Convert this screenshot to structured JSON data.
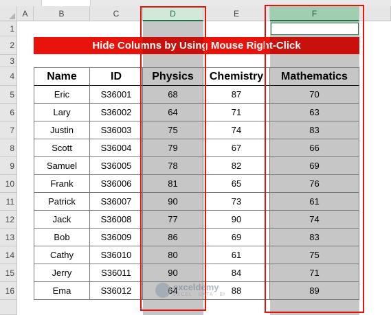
{
  "sheet": {
    "columns": [
      "A",
      "B",
      "C",
      "D",
      "E",
      "F"
    ],
    "rows": [
      "1",
      "2",
      "3",
      "4",
      "5",
      "6",
      "7",
      "8",
      "9",
      "10",
      "11",
      "12",
      "13",
      "14",
      "15",
      "16"
    ],
    "title": "Hide Columns by Using Mouse Right-Click",
    "headers": [
      "Name",
      "ID",
      "Physics",
      "Chemistry",
      "Mathematics"
    ],
    "data": [
      [
        "Eric",
        "S36001",
        "68",
        "87",
        "70"
      ],
      [
        "Lary",
        "S36002",
        "64",
        "71",
        "63"
      ],
      [
        "Justin",
        "S36003",
        "75",
        "74",
        "83"
      ],
      [
        "Scott",
        "S36004",
        "79",
        "67",
        "66"
      ],
      [
        "Samuel",
        "S36005",
        "78",
        "82",
        "69"
      ],
      [
        "Frank",
        "S36006",
        "81",
        "65",
        "76"
      ],
      [
        "Patrick",
        "S36007",
        "90",
        "73",
        "61"
      ],
      [
        "Jack",
        "S36008",
        "77",
        "90",
        "74"
      ],
      [
        "Bob",
        "S36009",
        "86",
        "69",
        "83"
      ],
      [
        "Cathy",
        "S36010",
        "80",
        "61",
        "75"
      ],
      [
        "Jerry",
        "S36011",
        "90",
        "84",
        "71"
      ],
      [
        "Ema",
        "S36012",
        "64",
        "88",
        "89"
      ]
    ],
    "selected_columns": [
      "D",
      "F"
    ],
    "highlight_color": "#e8140c",
    "selection_color": "#217346"
  },
  "watermark": {
    "name": "exceldemy",
    "tagline": "EXCEL · DATA · BI"
  }
}
